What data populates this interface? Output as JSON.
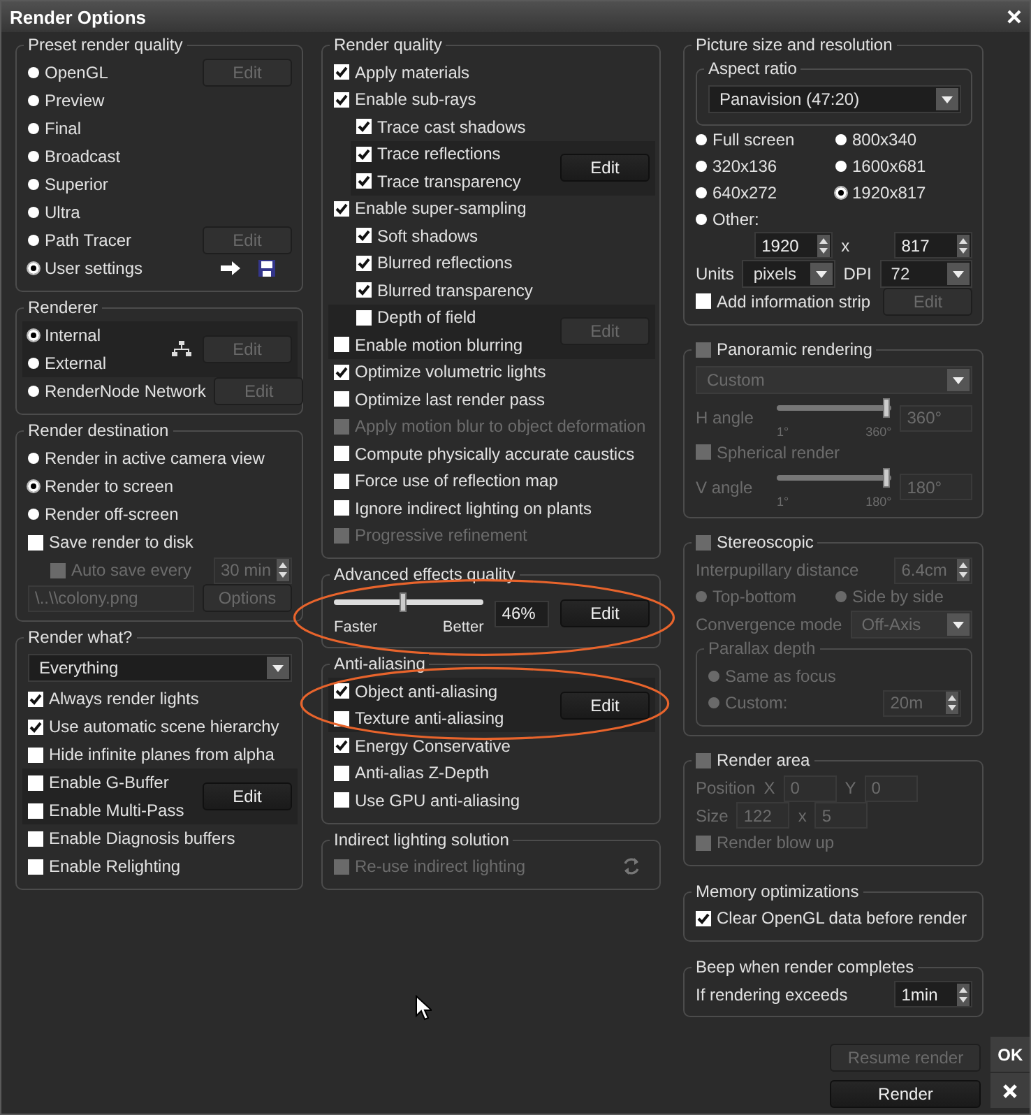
{
  "window": {
    "title": "Render Options"
  },
  "pointer": true,
  "columns": [
    {
      "groups": [
        {
          "legend": "Preset render quality",
          "rows": [
            {
              "kind": "radio",
              "label": "OpenGL",
              "selected": false,
              "button": {
                "label": "Edit",
                "disabled": true
              }
            },
            {
              "kind": "radio",
              "label": "Preview",
              "selected": false
            },
            {
              "kind": "radio",
              "label": "Final",
              "selected": false
            },
            {
              "kind": "radio",
              "label": "Broadcast",
              "selected": false
            },
            {
              "kind": "radio",
              "label": "Superior",
              "selected": false
            },
            {
              "kind": "radio",
              "label": "Ultra",
              "selected": false
            },
            {
              "kind": "radio",
              "label": "Path Tracer",
              "selected": false,
              "button": {
                "label": "Edit",
                "disabled": true
              }
            },
            {
              "kind": "line",
              "items": [
                {
                  "kind": "radio",
                  "label": "User settings",
                  "selected": true
                },
                {
                  "kind": "arrow"
                },
                {
                  "kind": "floppy"
                }
              ]
            }
          ]
        },
        {
          "legend": "Renderer",
          "rows": [
            {
              "kind": "block",
              "rows": [
                {
                  "kind": "radio",
                  "label": "Internal",
                  "selected": true
                },
                {
                  "kind": "radio",
                  "label": "External",
                  "selected": false
                }
              ],
              "side": [
                {
                  "kind": "network"
                },
                {
                  "kind": "button",
                  "label": "Edit",
                  "disabled": true
                }
              ]
            },
            {
              "kind": "radio",
              "label": "RenderNode Network",
              "selected": false,
              "button": {
                "label": "Edit",
                "disabled": true
              }
            }
          ]
        },
        {
          "legend": "Render destination",
          "rows": [
            {
              "kind": "radio",
              "label": "Render in active camera view",
              "selected": false
            },
            {
              "kind": "radio",
              "label": "Render to screen",
              "selected": true
            },
            {
              "kind": "radio",
              "label": "Render off-screen",
              "selected": false
            },
            {
              "kind": "check",
              "label": "Save render to disk",
              "checked": false,
              "children": [
                {
                  "kind": "line",
                  "items": [
                    {
                      "kind": "check",
                      "label": "Auto save every",
                      "checked": false,
                      "disabled": true
                    },
                    {
                      "kind": "spinner",
                      "value": "30 min",
                      "disabled": true
                    }
                  ]
                }
              ]
            },
            {
              "kind": "line",
              "items": [
                {
                  "kind": "field",
                  "value": "\\..\\\\colony.png",
                  "disabled": true
                },
                {
                  "kind": "button",
                  "label": "Options",
                  "disabled": true
                }
              ]
            }
          ]
        },
        {
          "legend": "Render what?",
          "rows": [
            {
              "kind": "dropdown",
              "value": "Everything"
            },
            {
              "kind": "check",
              "label": "Always render lights",
              "checked": true
            },
            {
              "kind": "check",
              "label": "Use automatic scene hierarchy",
              "checked": true
            },
            {
              "kind": "check",
              "label": "Hide infinite planes from alpha",
              "checked": false
            },
            {
              "kind": "block",
              "rows": [
                {
                  "kind": "check",
                  "label": "Enable G-Buffer",
                  "checked": false
                },
                {
                  "kind": "check",
                  "label": "Enable Multi-Pass",
                  "checked": false
                }
              ],
              "side": [
                {
                  "kind": "button",
                  "label": "Edit",
                  "disabled": false
                }
              ]
            },
            {
              "kind": "check",
              "label": "Enable Diagnosis buffers",
              "checked": false
            },
            {
              "kind": "check",
              "label": "Enable Relighting",
              "checked": false
            }
          ]
        }
      ]
    },
    {
      "groups": [
        {
          "legend": "Render quality",
          "rows": [
            {
              "kind": "check",
              "label": "Apply materials",
              "checked": true
            },
            {
              "kind": "check",
              "label": "Enable sub-rays",
              "checked": true,
              "children": [
                {
                  "kind": "check",
                  "label": "Trace cast shadows",
                  "checked": true
                },
                {
                  "kind": "block",
                  "rows": [
                    {
                      "kind": "check",
                      "label": "Trace reflections",
                      "checked": true
                    },
                    {
                      "kind": "check",
                      "label": "Trace transparency",
                      "checked": true
                    }
                  ],
                  "side": [
                    {
                      "kind": "button",
                      "label": "Edit",
                      "disabled": false
                    }
                  ]
                }
              ]
            },
            {
              "kind": "check",
              "label": "Enable super-sampling",
              "checked": true,
              "children": [
                {
                  "kind": "check",
                  "label": "Soft shadows",
                  "checked": true
                },
                {
                  "kind": "check",
                  "label": "Blurred reflections",
                  "checked": true
                },
                {
                  "kind": "check",
                  "label": "Blurred transparency",
                  "checked": true
                }
              ]
            },
            {
              "kind": "block",
              "rows": [
                {
                  "kind": "indent",
                  "children": [
                    {
                      "kind": "check",
                      "label": "Depth of field",
                      "checked": false
                    }
                  ]
                },
                {
                  "kind": "check",
                  "label": "Enable motion blurring",
                  "checked": false
                }
              ],
              "side": [
                {
                  "kind": "button",
                  "label": "Edit",
                  "disabled": true
                }
              ]
            },
            {
              "kind": "check",
              "label": "Optimize volumetric lights",
              "checked": true
            },
            {
              "kind": "check",
              "label": "Optimize last render pass",
              "checked": false
            },
            {
              "kind": "check",
              "label": "Apply motion blur to object deformation",
              "checked": false,
              "disabled": true
            },
            {
              "kind": "check",
              "label": "Compute physically accurate caustics",
              "checked": false
            },
            {
              "kind": "check",
              "label": "Force use of reflection map",
              "checked": false
            },
            {
              "kind": "check",
              "label": "Ignore indirect lighting on plants",
              "checked": false
            },
            {
              "kind": "check",
              "label": "Progressive refinement",
              "checked": false,
              "disabled": true
            }
          ]
        },
        {
          "legend": "Advanced effects quality",
          "circled": true,
          "rows": [
            {
              "kind": "slider",
              "level": 0.46,
              "min": "Faster",
              "max": "Better",
              "value": "46%",
              "button": {
                "label": "Edit",
                "disabled": false
              }
            }
          ]
        },
        {
          "legend": "Anti-aliasing",
          "rows": [
            {
              "kind": "block",
              "circled": true,
              "rows": [
                {
                  "kind": "check",
                  "label": "Object anti-aliasing",
                  "checked": true
                },
                {
                  "kind": "check",
                  "label": "Texture anti-aliasing",
                  "checked": false
                }
              ],
              "side": [
                {
                  "kind": "button",
                  "label": "Edit",
                  "disabled": false
                }
              ]
            },
            {
              "kind": "check",
              "label": "Energy Conservative",
              "checked": true
            },
            {
              "kind": "check",
              "label": "Anti-alias Z-Depth",
              "checked": false
            },
            {
              "kind": "check",
              "label": "Use GPU anti-aliasing",
              "checked": false
            }
          ]
        },
        {
          "legend": "Indirect lighting solution",
          "rows": [
            {
              "kind": "line",
              "items": [
                {
                  "kind": "check",
                  "label": "Re-use indirect lighting",
                  "checked": false,
                  "disabled": true
                },
                {
                  "kind": "refresh"
                }
              ]
            }
          ]
        }
      ]
    },
    {
      "groups": [
        {
          "legend": "Picture size and resolution",
          "rows": [
            {
              "kind": "subgroup",
              "legend": "Aspect ratio",
              "rows": [
                {
                  "kind": "dropdown",
                  "value": "Panavision (47:20)"
                }
              ]
            },
            {
              "kind": "grid",
              "items": [
                {
                  "kind": "radio",
                  "label": "Full screen",
                  "selected": false
                },
                {
                  "kind": "radio",
                  "label": "800x340",
                  "selected": false
                },
                {
                  "kind": "radio",
                  "label": "320x136",
                  "selected": false
                },
                {
                  "kind": "radio",
                  "label": "1600x681",
                  "selected": false
                },
                {
                  "kind": "radio",
                  "label": "640x272",
                  "selected": false
                },
                {
                  "kind": "radio",
                  "label": "1920x817",
                  "selected": true
                },
                {
                  "kind": "radio",
                  "label": "Other:",
                  "selected": false
                }
              ]
            },
            {
              "kind": "indent",
              "children": [
                {
                  "kind": "line",
                  "items": [
                    {
                      "kind": "spinner",
                      "value": "1920"
                    },
                    {
                      "kind": "text",
                      "text": "x"
                    },
                    {
                      "kind": "spinner",
                      "value": "817"
                    }
                  ]
                }
              ]
            },
            {
              "kind": "line",
              "items": [
                {
                  "kind": "text",
                  "text": "Units"
                },
                {
                  "kind": "dropdown",
                  "value": "pixels"
                },
                {
                  "kind": "text",
                  "text": "DPI"
                },
                {
                  "kind": "dropdown",
                  "value": "72"
                }
              ]
            },
            {
              "kind": "line",
              "items": [
                {
                  "kind": "check",
                  "label": "Add information strip",
                  "checked": false
                },
                {
                  "kind": "button",
                  "label": "Edit",
                  "disabled": true
                }
              ]
            }
          ]
        },
        {
          "legend": "Panoramic rendering",
          "legend_check": false,
          "disabled": true,
          "rows": [
            {
              "kind": "dropdown",
              "value": "Custom"
            },
            {
              "kind": "angle",
              "label": "H angle",
              "level": 1,
              "min": "1°",
              "max": "360°",
              "value": "360°"
            },
            {
              "kind": "check",
              "label": "Spherical render",
              "checked": false
            },
            {
              "kind": "angle",
              "label": "V angle",
              "level": 1,
              "min": "1°",
              "max": "180°",
              "value": "180°"
            }
          ]
        },
        {
          "legend": "Stereoscopic",
          "legend_check": false,
          "disabled": true,
          "rows": [
            {
              "kind": "line",
              "items": [
                {
                  "kind": "text",
                  "text": "Interpupillary distance"
                },
                {
                  "kind": "spinner",
                  "value": "6.4cm"
                }
              ]
            },
            {
              "kind": "grid",
              "items": [
                {
                  "kind": "radio",
                  "label": "Top-bottom",
                  "selected": false
                },
                {
                  "kind": "radio",
                  "label": "Side by side",
                  "selected": false
                }
              ]
            },
            {
              "kind": "line",
              "items": [
                {
                  "kind": "text",
                  "text": "Convergence mode"
                },
                {
                  "kind": "dropdown",
                  "value": "Off-Axis"
                }
              ]
            },
            {
              "kind": "subgroup",
              "legend": "Parallax depth",
              "rows": [
                {
                  "kind": "radio",
                  "label": "Same as focus",
                  "selected": false
                },
                {
                  "kind": "line",
                  "items": [
                    {
                      "kind": "radio",
                      "label": "Custom:",
                      "selected": false
                    },
                    {
                      "kind": "spinner",
                      "value": "20m"
                    }
                  ]
                }
              ]
            }
          ]
        },
        {
          "legend": "Render area",
          "legend_check": false,
          "disabled": true,
          "rows": [
            {
              "kind": "line",
              "items": [
                {
                  "kind": "text",
                  "text": "Position"
                },
                {
                  "kind": "text",
                  "text": "X"
                },
                {
                  "kind": "field",
                  "value": "0"
                },
                {
                  "kind": "text",
                  "text": "Y"
                },
                {
                  "kind": "field",
                  "value": "0"
                }
              ]
            },
            {
              "kind": "line",
              "items": [
                {
                  "kind": "text",
                  "text": "Size"
                },
                {
                  "kind": "field",
                  "value": "122"
                },
                {
                  "kind": "text",
                  "text": "x"
                },
                {
                  "kind": "field",
                  "value": "5"
                }
              ]
            },
            {
              "kind": "check",
              "label": "Render blow up",
              "checked": false
            }
          ]
        },
        {
          "legend": "Memory optimizations",
          "rows": [
            {
              "kind": "check",
              "label": "Clear OpenGL data before render",
              "checked": true
            }
          ]
        },
        {
          "legend": "Beep when render completes",
          "rows": [
            {
              "kind": "line",
              "items": [
                {
                  "kind": "text",
                  "text": "If rendering exceeds"
                },
                {
                  "kind": "spinner",
                  "value": "1min"
                }
              ]
            }
          ]
        }
      ]
    }
  ],
  "actions": [
    {
      "label": "Resume render",
      "disabled": true
    },
    {
      "label": "Render",
      "disabled": false
    }
  ],
  "side_buttons": [
    {
      "kind": "ok",
      "label": "OK"
    },
    {
      "kind": "close"
    }
  ]
}
